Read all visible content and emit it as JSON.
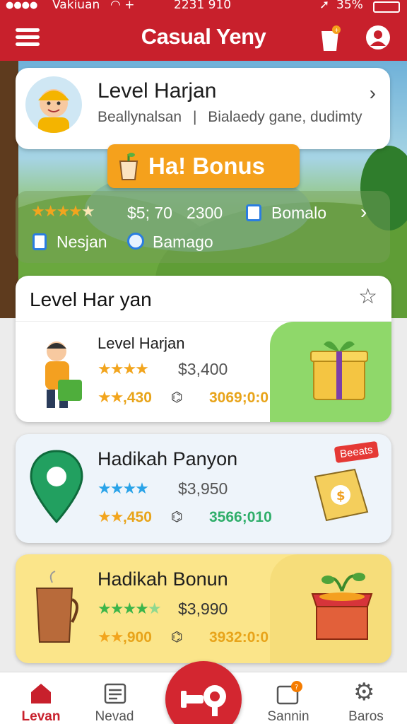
{
  "status_bar": {
    "carrier": "Vakiuan",
    "time": "2231 910",
    "battery": "35%"
  },
  "header": {
    "title": "Casual Yeny"
  },
  "profile_card": {
    "title": "Level Harjan",
    "subtitle_left": "Beallynalsan",
    "subtitle_right": "Bialaedy gane, dudimty"
  },
  "bonus_banner": {
    "label": "Ha! Bonus"
  },
  "stats_panel": {
    "price": "$5; 70",
    "count": "2300",
    "bomalo_label": "Bomalo",
    "nesjan_label": "Nesjan",
    "bamago_label": "Bamago"
  },
  "section": {
    "title": "Level Har yan"
  },
  "offers": [
    {
      "name": "Level Harjan",
      "price": "$3,400",
      "sub_value": ",430",
      "code": "3069;0:0",
      "code_color": "#e8a41a"
    },
    {
      "name": "Hadikah Panyon",
      "price": "$3,950",
      "sub_value": ",450",
      "code": "3566;010",
      "code_color": "#2fae6a",
      "badge": "Beeats"
    },
    {
      "name": "Hadikah Bonun",
      "price": "$3,990",
      "sub_value": ",900",
      "code": "3932:0:0",
      "code_color": "#e8a41a"
    }
  ],
  "tabs": [
    {
      "label": "Levan",
      "active": true
    },
    {
      "label": "Nevad",
      "active": false
    },
    {
      "label": "Sannin",
      "active": false
    },
    {
      "label": "Baros",
      "active": false
    }
  ],
  "colors": {
    "brand_red": "#c8202c",
    "bonus_orange": "#f5a11c",
    "star_gold": "#f2a51e",
    "star_blue": "#2aa3e8",
    "star_green": "#3cb54a"
  }
}
